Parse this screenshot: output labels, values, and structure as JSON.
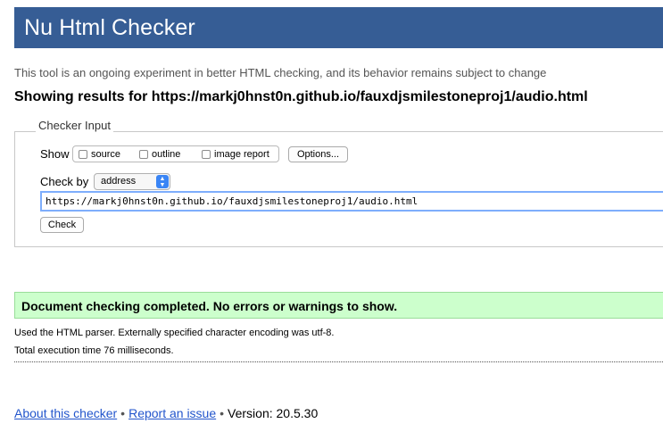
{
  "header": {
    "title": "Nu Html Checker"
  },
  "tagline": "This tool is an ongoing experiment in better HTML checking, and its behavior remains subject to change",
  "results_heading": "Showing results for https://markj0hnst0n.github.io/fauxdjsmilestoneproj1/audio.html",
  "checker_input": {
    "legend": "Checker Input",
    "show_label": "Show",
    "options": [
      {
        "label": "source",
        "checked": false
      },
      {
        "label": "outline",
        "checked": false
      },
      {
        "label": "image report",
        "checked": false
      }
    ],
    "options_button": "Options...",
    "check_by_label": "Check by",
    "check_by_value": "address",
    "url_value": "https://markj0hnst0n.github.io/fauxdjsmilestoneproj1/audio.html",
    "check_button": "Check"
  },
  "result": {
    "message": "Document checking completed. No errors or warnings to show.",
    "parser_line": "Used the HTML parser. Externally specified character encoding was utf-8.",
    "time_line": "Total execution time 76 milliseconds."
  },
  "footer": {
    "about_link": "About this checker",
    "separator": "•",
    "report_link": "Report an issue",
    "version_text": "Version: 20.5.30"
  },
  "colors": {
    "header_bg": "#365d95",
    "success_bg": "#ccffcc",
    "link": "#2255cc"
  }
}
